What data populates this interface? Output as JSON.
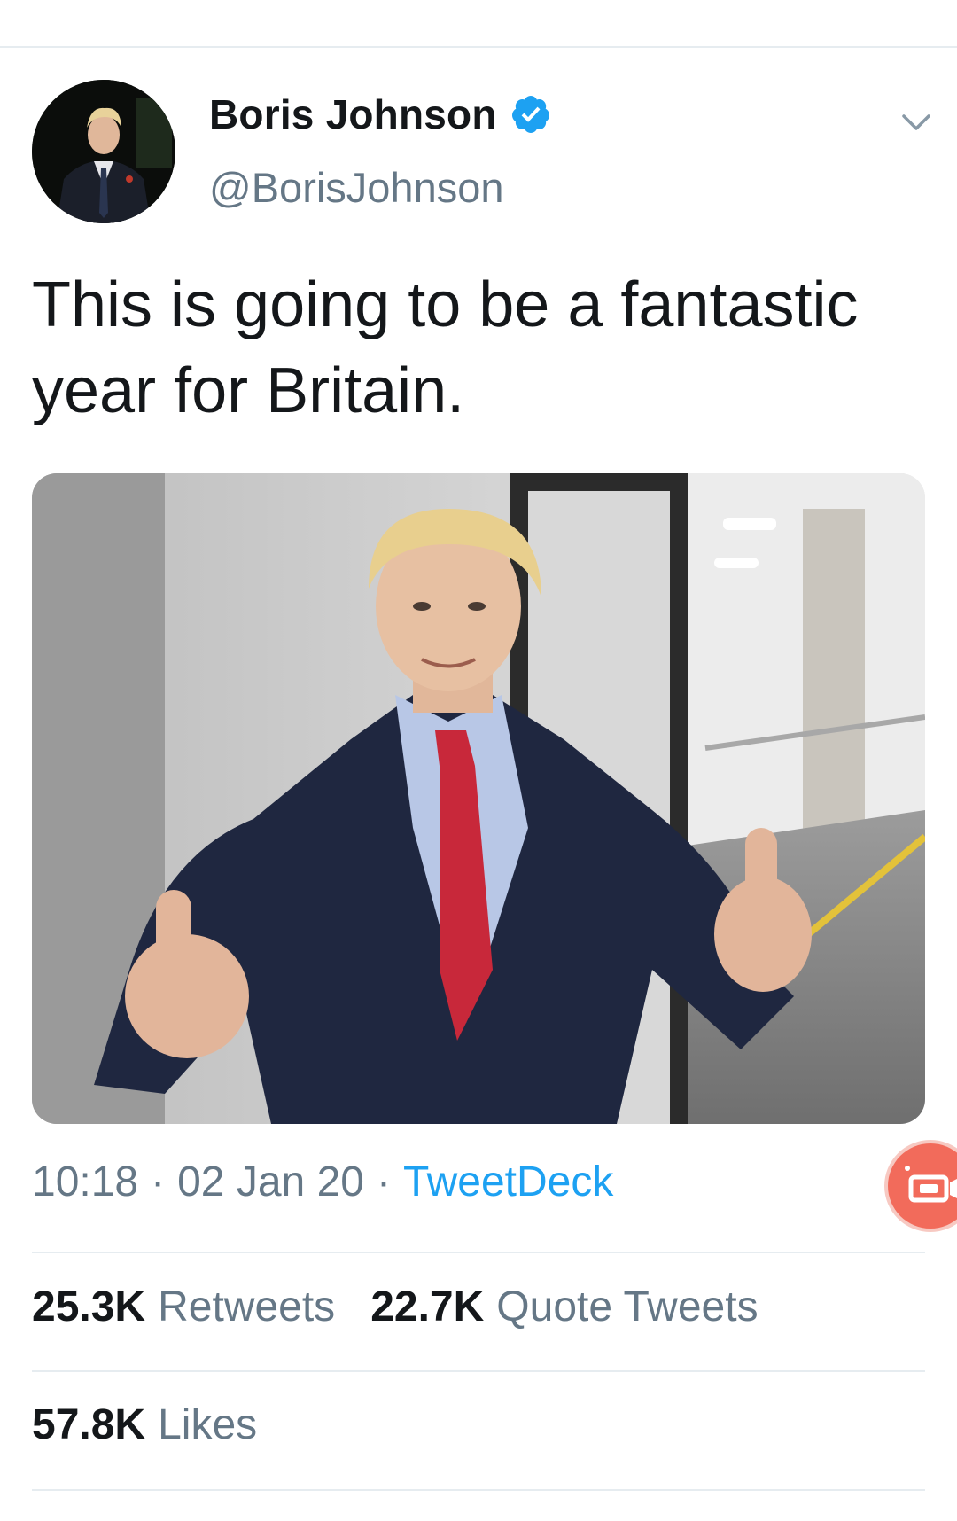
{
  "tweet": {
    "author": {
      "display_name": "Boris Johnson",
      "handle": "@BorisJohnson",
      "verified": true
    },
    "text": "This is going to be a fantastic year for Britain.",
    "time": "10:18",
    "separator": "·",
    "date": "02 Jan 20",
    "source": "TweetDeck"
  },
  "stats": {
    "retweets": {
      "count": "25.3K",
      "label": "Retweets"
    },
    "quote_tweets": {
      "count": "22.7K",
      "label": "Quote Tweets"
    },
    "likes": {
      "count": "57.8K",
      "label": "Likes"
    }
  },
  "icons": {
    "verified": "verified-badge-icon",
    "menu": "chevron-down-icon",
    "fab": "screen-record-icon"
  },
  "colors": {
    "link_blue": "#1da1f2",
    "secondary_text": "#657786",
    "primary_text": "#14171a",
    "divider": "#e6ecf0",
    "fab": "#f26b5b"
  }
}
